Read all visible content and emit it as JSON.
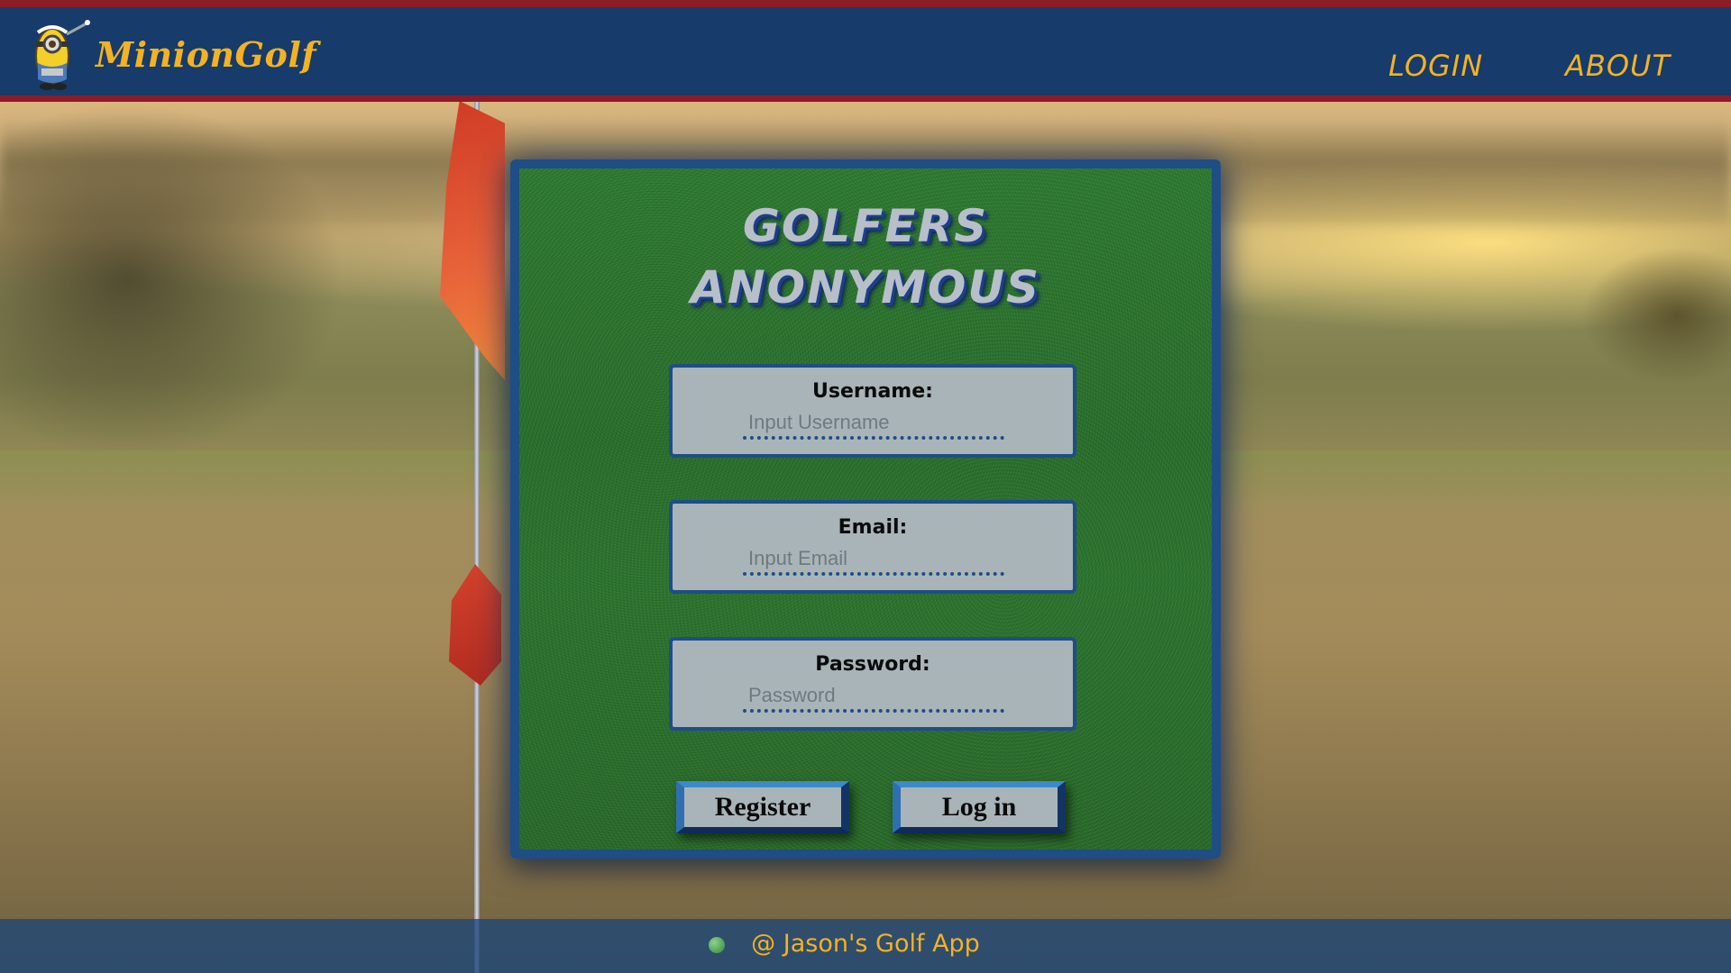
{
  "header": {
    "brand": "MinionGolf",
    "nav": [
      {
        "label": "LOGIN"
      },
      {
        "label": "ABOUT"
      }
    ]
  },
  "card": {
    "title_line1": "GOLFERS",
    "title_line2": "ANONYMOUS",
    "fields": {
      "username": {
        "label": "Username:",
        "placeholder": "Input Username"
      },
      "email": {
        "label": "Email:",
        "placeholder": "Input Email"
      },
      "password": {
        "label": "Password:",
        "placeholder": "Password"
      }
    },
    "buttons": {
      "register": "Register",
      "login": "Log in"
    }
  },
  "footer": {
    "text": "@ Jason's Golf App"
  },
  "colors": {
    "header_bg": "#173b6a",
    "accent_gold": "#f2b224",
    "stripe_red": "#8c1c26",
    "card_border": "#1f4d86"
  }
}
